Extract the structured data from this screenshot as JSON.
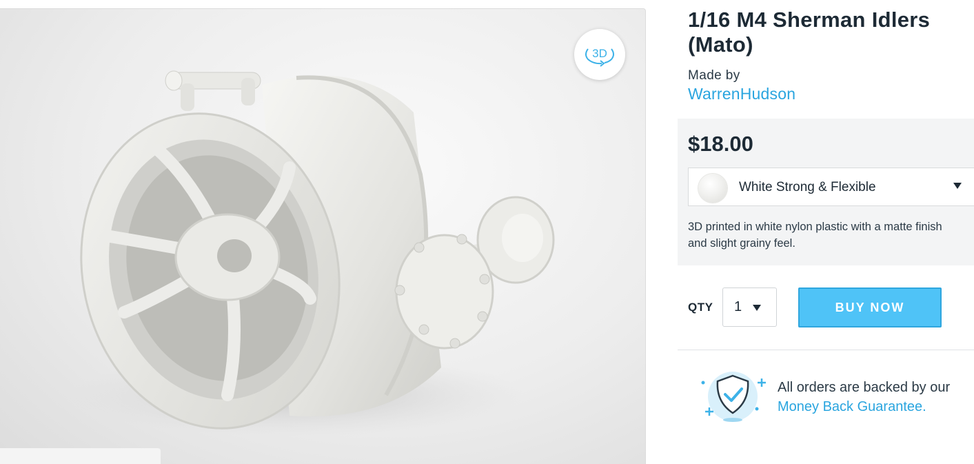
{
  "viewer": {
    "view_3d_label": "3D",
    "rotate_icon": "rotate-3d-icon"
  },
  "product": {
    "title": "1/16 M4 Sherman Idlers (Mato)",
    "made_by_label": "Made by",
    "designer": "WarrenHudson"
  },
  "purchase": {
    "price": "$18.00",
    "material": {
      "selected": "White Strong & Flexible",
      "swatch_color": "#f1f1ef",
      "description": "3D printed in white nylon plastic with a matte finish and slight grainy feel."
    },
    "qty_label": "QTY",
    "qty_value": "1",
    "buy_label": "BUY NOW"
  },
  "guarantee": {
    "icon": "shield-check-icon",
    "text": "All orders are backed by our",
    "link": "Money Back Guarantee."
  },
  "colors": {
    "accent": "#2aa5df",
    "buy_button": "#4fc3f7",
    "text_dark": "#1d2a35",
    "panel_bg": "#f3f4f5"
  }
}
